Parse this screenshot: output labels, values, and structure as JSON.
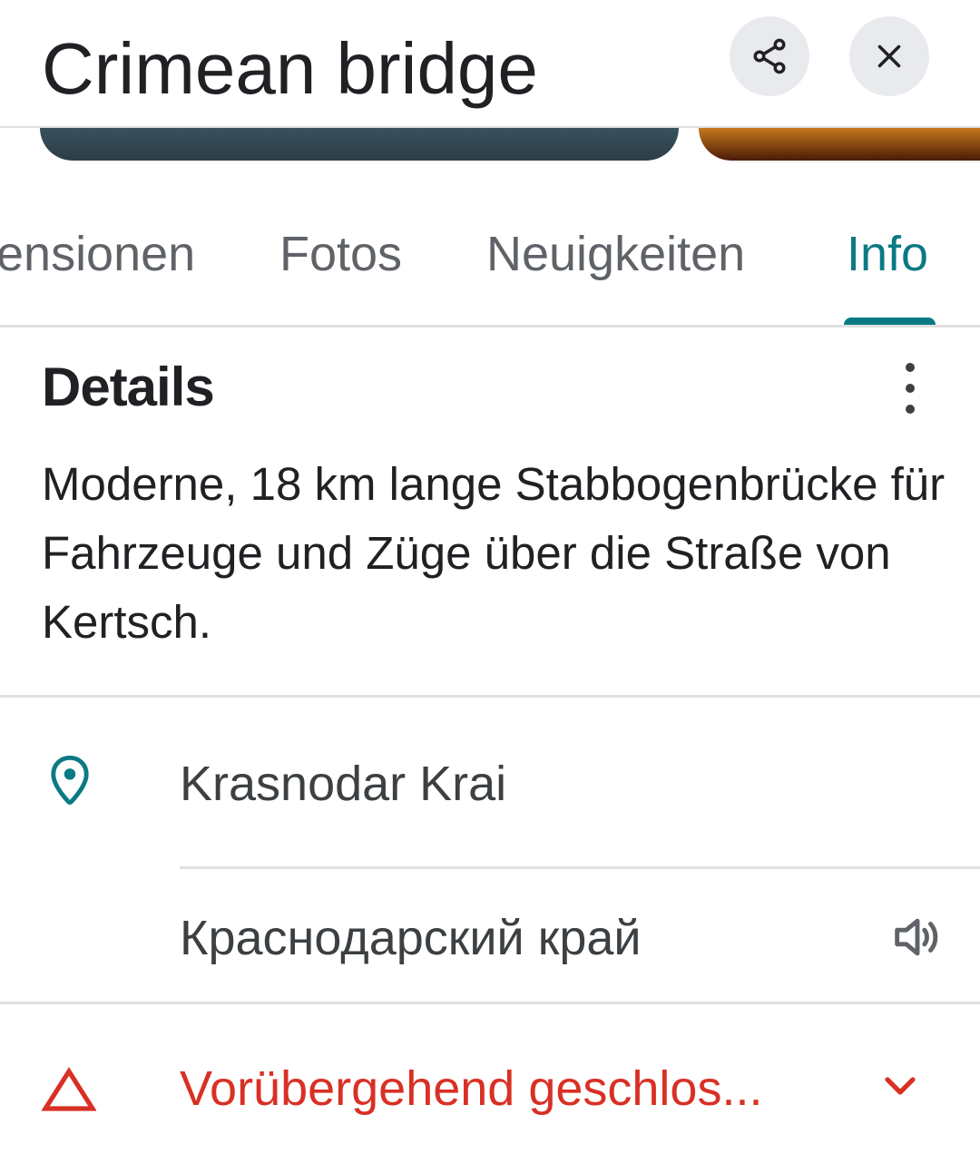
{
  "header": {
    "title": "Crimean bridge"
  },
  "icons": {
    "share": "share-icon",
    "close": "close-icon",
    "more": "more-vert-icon",
    "location": "location-pin-icon",
    "speaker": "speaker-icon",
    "warning": "warning-triangle-icon",
    "expand": "chevron-down-icon"
  },
  "tabs": [
    {
      "label": "ensionen",
      "active": false
    },
    {
      "label": "Fotos",
      "active": false
    },
    {
      "label": "Neuigkeiten",
      "active": false
    },
    {
      "label": "Info",
      "active": true
    }
  ],
  "details": {
    "title": "Details",
    "description": "Moderne, 18 km lange Stabbogenbrücke für Fahrzeuge und Züge über die Straße von Kertsch."
  },
  "location": {
    "name_latin": "Krasnodar Krai",
    "name_native": "Краснодарский край"
  },
  "status": {
    "text": "Vorübergehend geschlos..."
  },
  "colors": {
    "accent": "#0b7a85",
    "warning": "#d93025",
    "text": "#202124",
    "secondary": "#5f6368"
  }
}
